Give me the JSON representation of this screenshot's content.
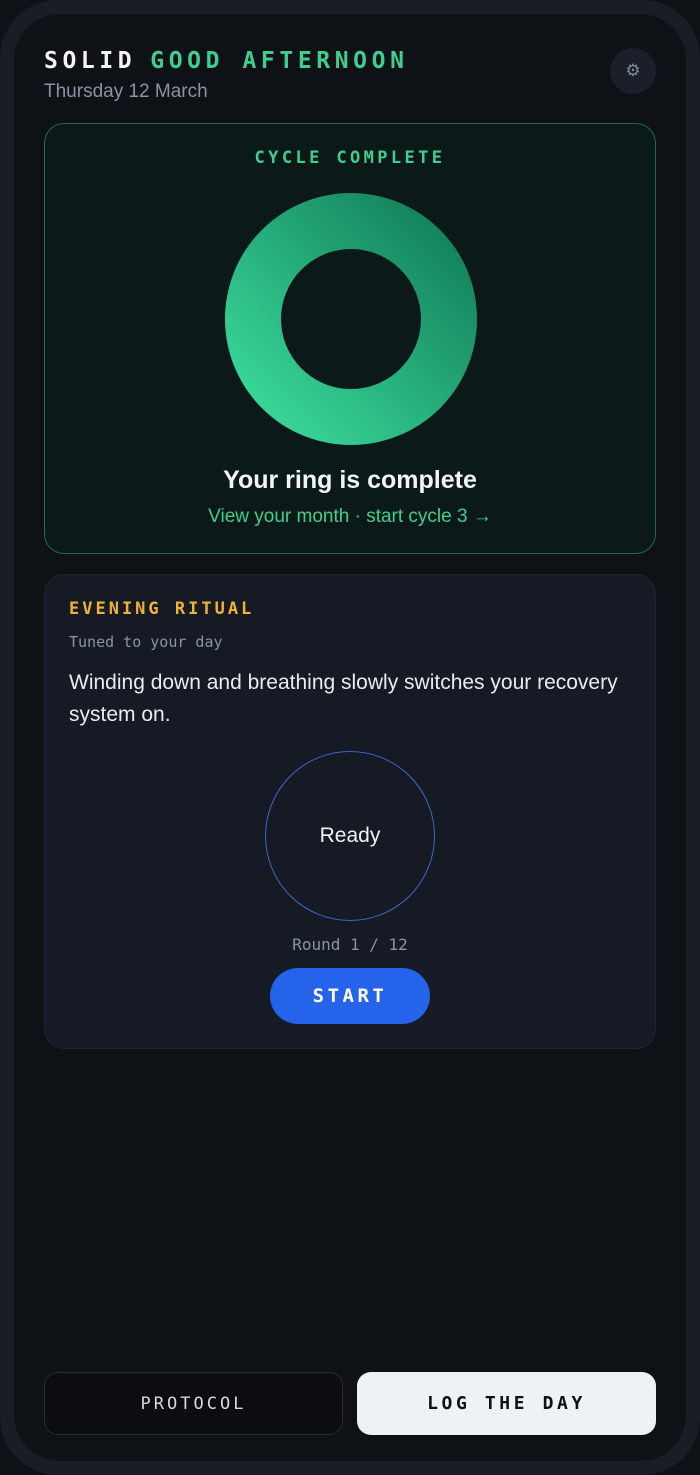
{
  "header": {
    "brand": "SOLID",
    "greeting": "GOOD AFTERNOON",
    "date": "Thursday 12 March",
    "settings_icon": "gear-icon"
  },
  "cycle": {
    "title": "CYCLE COMPLETE",
    "headline": "Your ring is complete",
    "link": "View your month · start cycle 3 →",
    "ring_progress": 1.0,
    "ring_colors": [
      "#3ad99a",
      "#12805a"
    ]
  },
  "ritual": {
    "title": "EVENING RITUAL",
    "subtitle": "Tuned to your day",
    "description": "Winding down and breathing slowly switches your recovery system on.",
    "status": "Ready",
    "round": "Round 1 / 12",
    "start_label": "START"
  },
  "footer": {
    "protocol_label": "PROTOCOL",
    "log_label": "LOG THE DAY"
  },
  "colors": {
    "accent_green": "#3ecf8e",
    "accent_amber": "#f0b232",
    "accent_blue": "#2563eb",
    "background": "#0e1116"
  }
}
